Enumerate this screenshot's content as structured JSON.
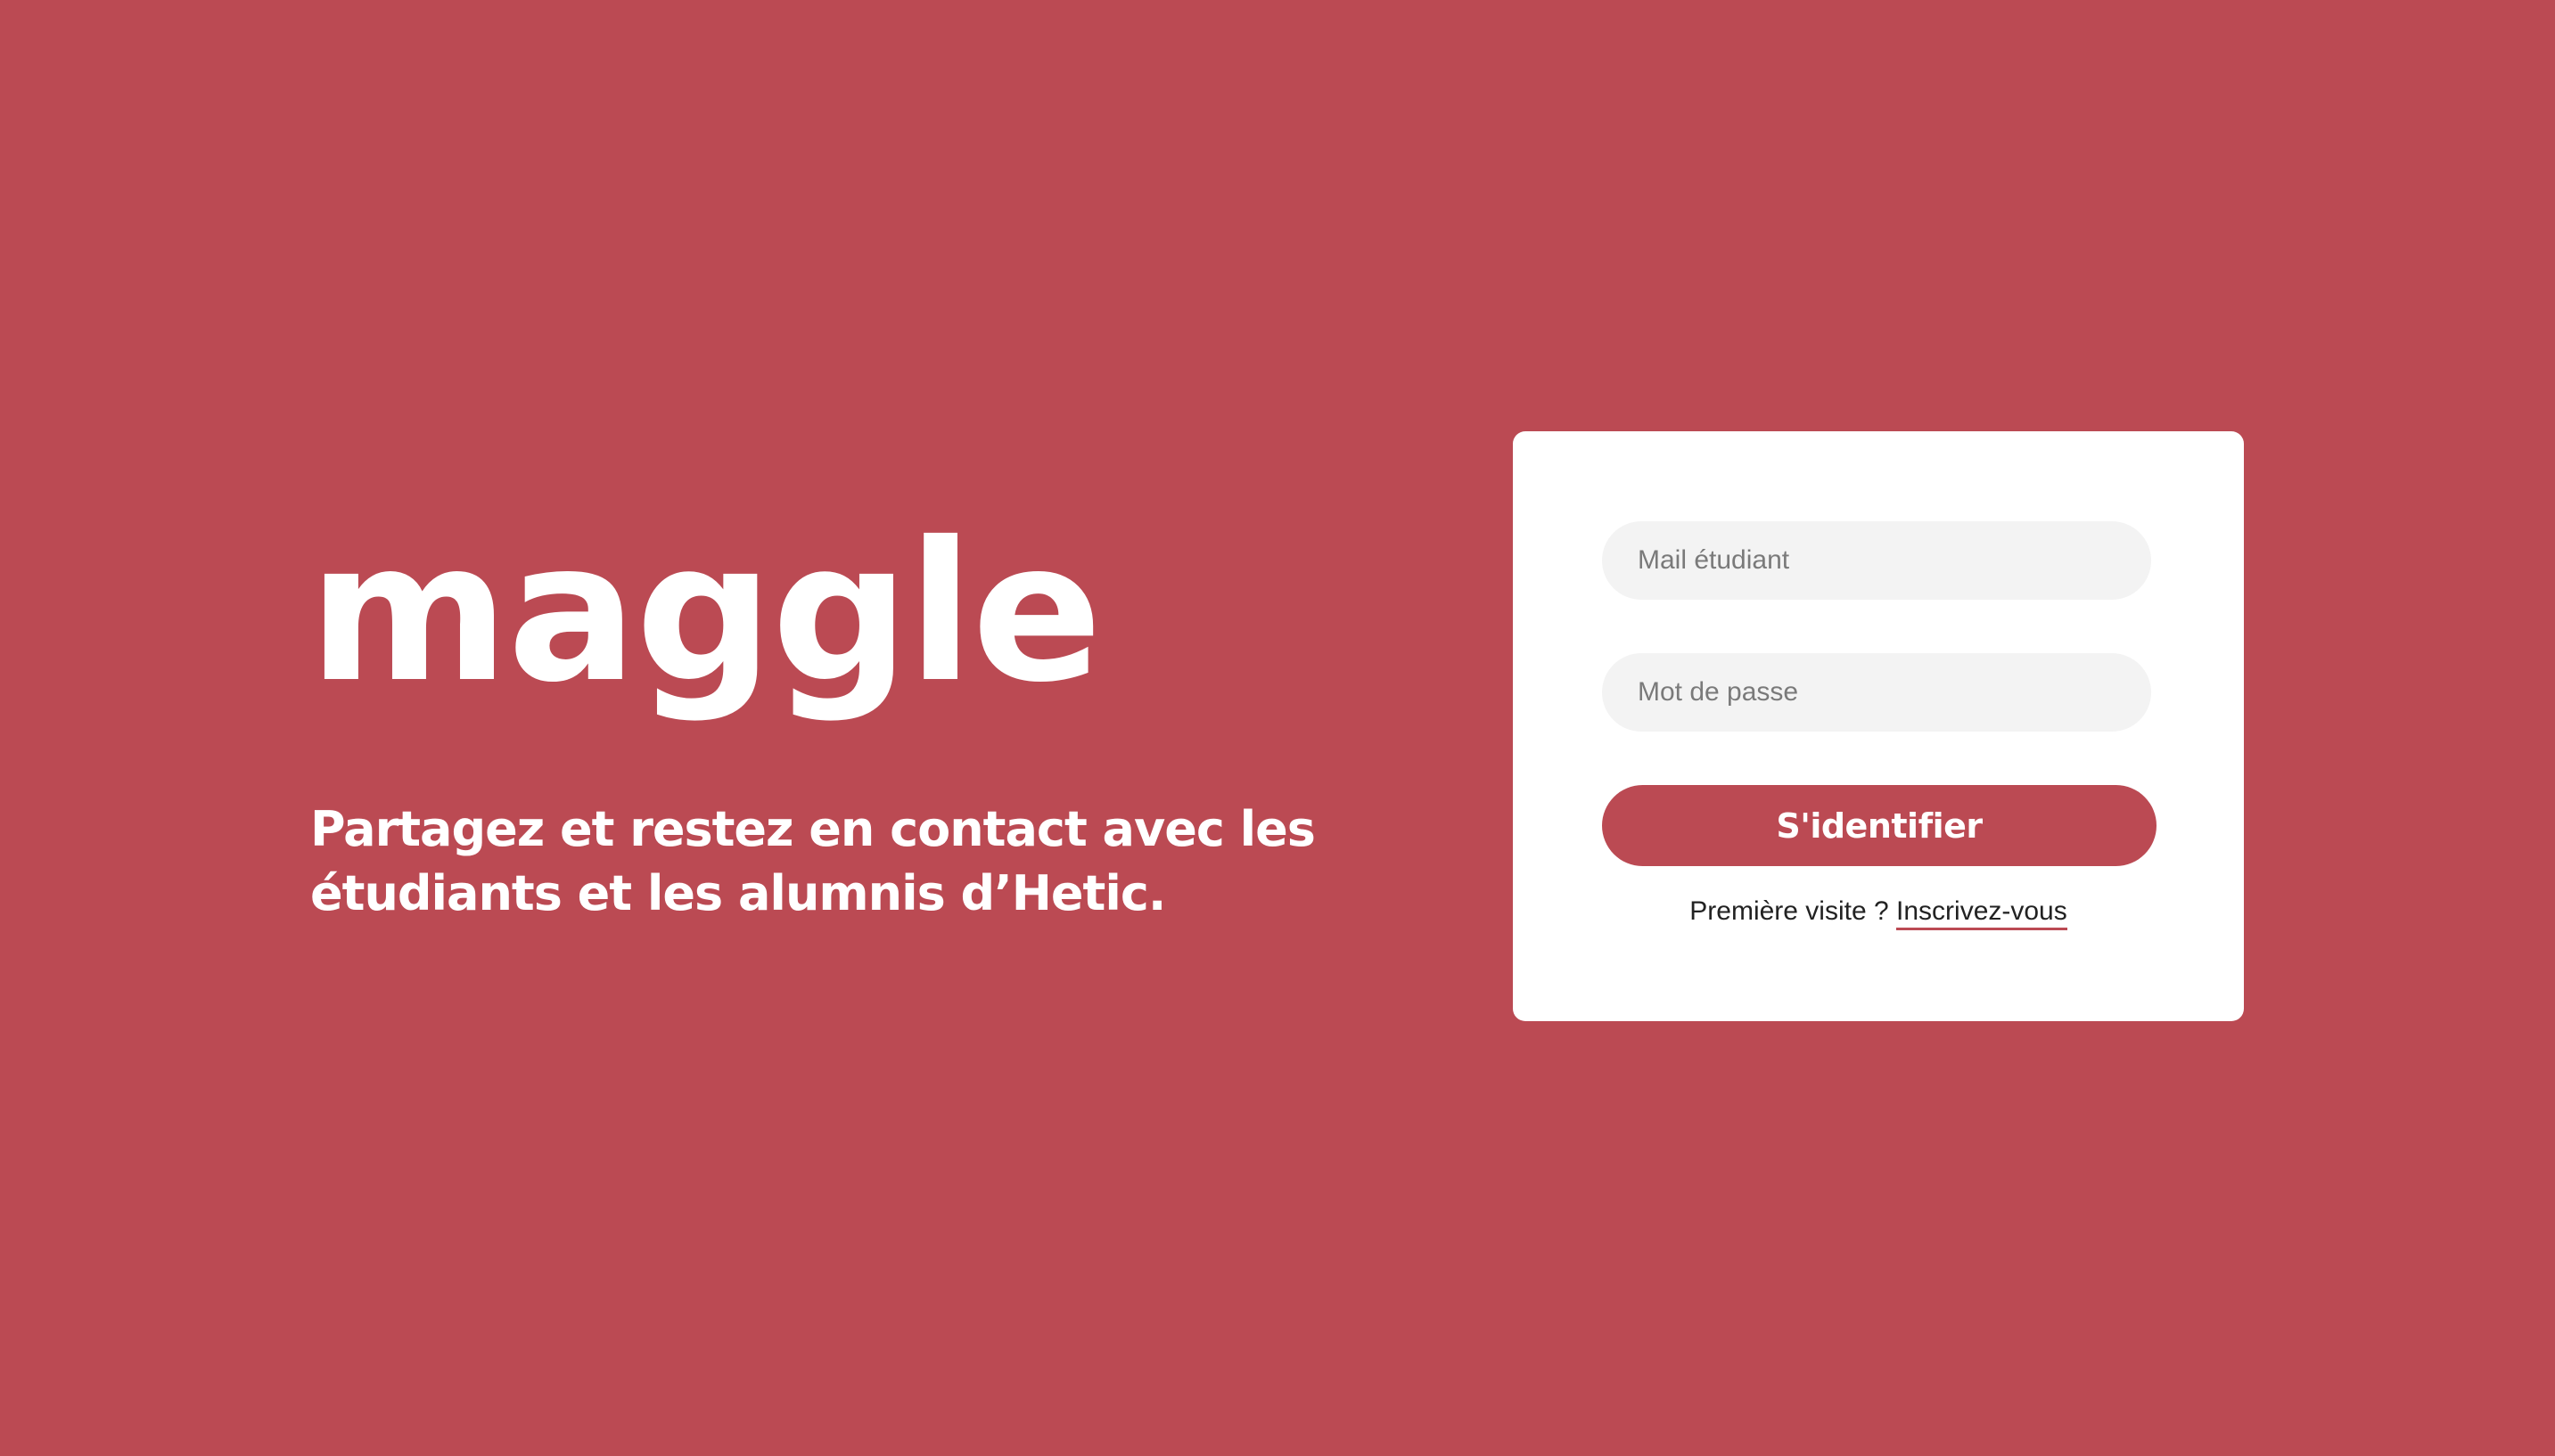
{
  "brand": {
    "name": "maggle",
    "tagline_line1": "Partagez et restez en contact avec les",
    "tagline_line2": "étudiants et les alumnis d’Hetic."
  },
  "login_form": {
    "email_placeholder": "Mail étudiant",
    "email_value": "",
    "password_placeholder": "Mot de passe",
    "password_value": "",
    "submit_label": "S'identifier",
    "signup_prompt": "Première visite ?",
    "signup_link": "Inscrivez-vous"
  },
  "colors": {
    "background": "#bb4a53",
    "accent": "#bb4a53",
    "card": "#ffffff",
    "field": "#f3f3f3"
  }
}
